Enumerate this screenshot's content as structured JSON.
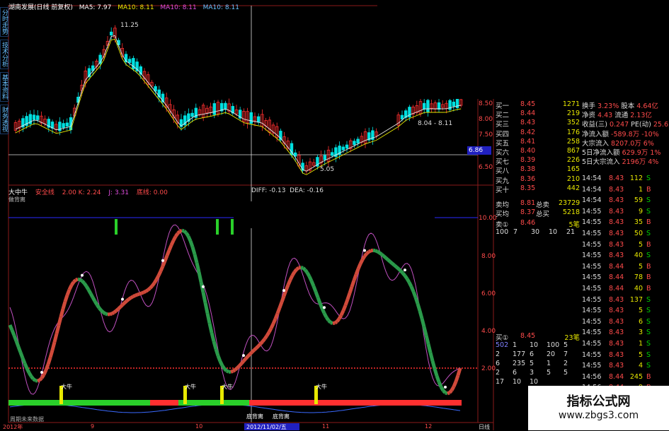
{
  "title_bar": {
    "stock": "湖南发展(日线 前复权)",
    "ma5": "MA5: 7.97",
    "ma10": "MA10: 8.11",
    "ma10b": "MA10: 8.11",
    "ma10c": "MA10: 8.11"
  },
  "side_tabs": [
    "分时走势",
    "技术分析",
    "基本资料",
    "财务透视"
  ],
  "price_chart": {
    "high_label": "11.25",
    "low_label": "5.05",
    "range_label": "8.04 - 8.11",
    "cursor_price": "6.86",
    "y_labels": [
      "8.50",
      "8.00",
      "7.50",
      "7.00",
      "6.50"
    ]
  },
  "oscillator": {
    "name": "大中牛",
    "safe": "安全线",
    "k": "2.00 K: 2.24",
    "j": "J: 3.31",
    "base": "底线: 0.00",
    "diff": "DIFF: -0.13",
    "dea": "DEA: -0.16",
    "sub": "做背离",
    "y_labels": [
      "10.00",
      "8.00",
      "6.00",
      "4.00",
      "2.00"
    ],
    "buy_marks": [
      "大牛",
      "大牛",
      "大牛",
      "大牛"
    ],
    "bottom_divergence": [
      "底背离",
      "底背离"
    ]
  },
  "bottom_bar": {
    "left": "周期未来数据",
    "date": "2012/11/02/五",
    "period": "日线",
    "months": [
      "2012年",
      "9",
      "10",
      "11",
      "12"
    ]
  },
  "order_book": [
    {
      "label": "买一",
      "price": "8.45",
      "vol": "1271"
    },
    {
      "label": "买二",
      "price": "8.44",
      "vol": "219"
    },
    {
      "label": "买三",
      "price": "8.43",
      "vol": "352"
    },
    {
      "label": "买四",
      "price": "8.42",
      "vol": "176"
    },
    {
      "label": "买五",
      "price": "8.41",
      "vol": "258"
    },
    {
      "label": "买六",
      "price": "8.40",
      "vol": "867"
    },
    {
      "label": "买七",
      "price": "8.39",
      "vol": "226"
    },
    {
      "label": "买八",
      "price": "8.38",
      "vol": "165"
    },
    {
      "label": "买九",
      "price": "8.36",
      "vol": "210"
    },
    {
      "label": "买十",
      "price": "8.35",
      "vol": "442"
    }
  ],
  "stats": [
    {
      "k": "换手",
      "v": "3.23%",
      "k2": "股本",
      "v2": "4.64亿"
    },
    {
      "k": "净资",
      "v": "4.43",
      "k2": "流通",
      "v2": "2.13亿"
    },
    {
      "k": "收益(三)",
      "v": "0.247",
      "k2": "PE(动)",
      "v2": "25.6"
    },
    {
      "k": "净流入额",
      "v": "-589.8万",
      "k2": "",
      "v2": "-10%"
    },
    {
      "k": "大宗流入",
      "v": "8207.0万",
      "k2": "",
      "v2": "6%"
    },
    {
      "k": "5日净流入额",
      "v": "629.9万",
      "k2": "",
      "v2": "1%"
    },
    {
      "k": "5日大宗流入",
      "v": "2196万",
      "k2": "",
      "v2": "4%"
    }
  ],
  "avg_rows": [
    {
      "k": "卖均",
      "v": "8.81",
      "k2": "总卖",
      "v2": "23729"
    },
    {
      "k": "买均",
      "v": "8.37",
      "k2": "总买",
      "v2": "5218"
    }
  ],
  "sell_queue": {
    "head": "卖①",
    "price": "8.46",
    "count": "5笔",
    "items": [
      "100",
      "7",
      "30",
      "10",
      "21"
    ]
  },
  "buy_queue": {
    "head": "买①",
    "price": "8.45",
    "count": "23笔",
    "rows": [
      [
        "502",
        "1",
        "10",
        "100",
        "5"
      ],
      [
        "2",
        "177",
        "6",
        "20",
        "7"
      ],
      [
        "6",
        "235",
        "5",
        "1",
        "2"
      ],
      [
        "2",
        "6",
        "3",
        "5",
        "5"
      ],
      [
        "17",
        "10",
        "10",
        "",
        ""
      ]
    ]
  },
  "ticks": [
    {
      "t": "14:54",
      "p": "8.43",
      "n": "112",
      "s": "S"
    },
    {
      "t": "14:54",
      "p": "8.43",
      "n": "1",
      "s": "B"
    },
    {
      "t": "14:54",
      "p": "8.43",
      "n": "59",
      "s": "S"
    },
    {
      "t": "14:55",
      "p": "8.43",
      "n": "9",
      "s": "S"
    },
    {
      "t": "14:55",
      "p": "8.43",
      "n": "35",
      "s": "B"
    },
    {
      "t": "14:55",
      "p": "8.43",
      "n": "50",
      "s": "S"
    },
    {
      "t": "14:55",
      "p": "8.43",
      "n": "5",
      "s": "B"
    },
    {
      "t": "14:55",
      "p": "8.43",
      "n": "40",
      "s": "S"
    },
    {
      "t": "14:55",
      "p": "8.44",
      "n": "5",
      "s": "B"
    },
    {
      "t": "14:55",
      "p": "8.44",
      "n": "78",
      "s": "B"
    },
    {
      "t": "14:55",
      "p": "8.44",
      "n": "40",
      "s": "B"
    },
    {
      "t": "14:55",
      "p": "8.43",
      "n": "137",
      "s": "S"
    },
    {
      "t": "14:55",
      "p": "8.43",
      "n": "5",
      "s": "S"
    },
    {
      "t": "14:55",
      "p": "8.43",
      "n": "6",
      "s": "S"
    },
    {
      "t": "14:55",
      "p": "8.43",
      "n": "3",
      "s": "S"
    },
    {
      "t": "14:55",
      "p": "8.43",
      "n": "1",
      "s": "S"
    },
    {
      "t": "14:55",
      "p": "8.43",
      "n": "5",
      "s": "S"
    },
    {
      "t": "14:55",
      "p": "8.43",
      "n": "4",
      "s": "S"
    },
    {
      "t": "14:56",
      "p": "8.44",
      "n": "245",
      "s": "B"
    },
    {
      "t": "14:56",
      "p": "8.44",
      "n": "9",
      "s": "B"
    },
    {
      "t": "15:00",
      "p": "8.45",
      "n": "210",
      "s": "B"
    }
  ],
  "watermark": {
    "title": "指标公式网",
    "url": "www.zbgs3.com"
  },
  "colors": {
    "up": "#ff3030",
    "down": "#00e0e0",
    "accent_buy": "#00d000",
    "sell_yellow": "#e8e800"
  }
}
